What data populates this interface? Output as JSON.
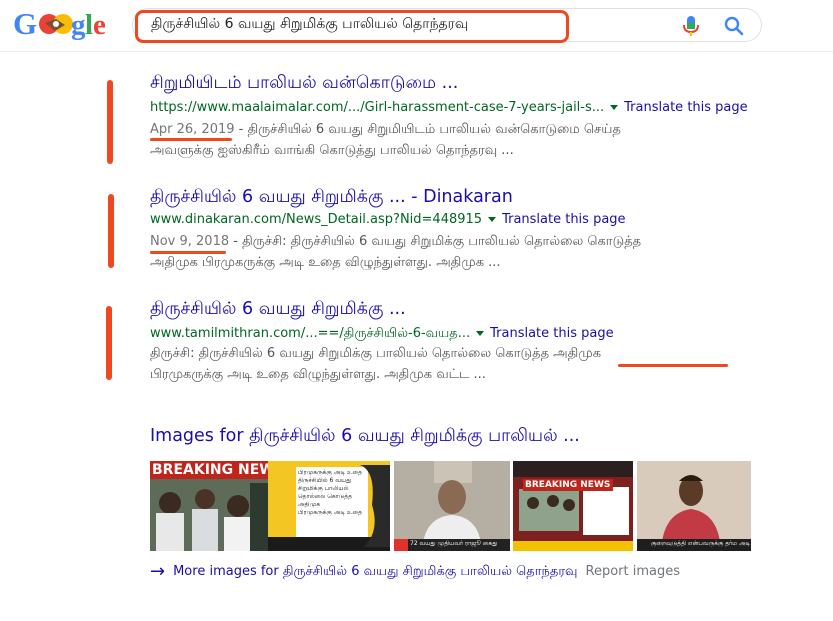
{
  "search": {
    "logo_text": "Google",
    "query": "திருச்சியில் 6 வயது சிறுமிக்கு பாலியல் தொந்தரவு",
    "mic_icon": "microphone-icon",
    "search_icon": "magnifier-icon"
  },
  "results": [
    {
      "title": "சிறுமியிடம் பாலியல் வன்கொடுமை ...",
      "url": "https://www.maalaimalar.com/.../Girl-harassment-case-7-years-jail-s...",
      "translate": "Translate this page",
      "date": "Apr 26, 2019",
      "sep": " - ",
      "snippet1": "திருச்சியில் 6 வயது சிறுமியிடம் பாலியல் வன்கொடுமை செய்த",
      "snippet2": "அவளுக்கு ஐஸ்கிரீம் வாங்கி கொடுத்து பாலியல் தொந்தரவு ..."
    },
    {
      "title": "திருச்சியில் 6 வயது சிறுமிக்கு ... - Dinakaran",
      "url": "www.dinakaran.com/News_Detail.asp?Nid=448915",
      "translate": "Translate this page",
      "date": "Nov 9, 2018",
      "sep": " - ",
      "snippet1": "திருச்சி: திருச்சியில் 6 வயது சிறுமிக்கு பாலியல் தொல்லை கொடுத்த",
      "snippet2": "அதிமுக பிரமுகருக்கு அடி உதை விழுந்துள்ளது. அதிமுக ..."
    },
    {
      "title": "திருச்சியில் 6 வயது சிறுமிக்கு ...",
      "url": "www.tamilmithran.com/...==/திருச்சியில்-6-வயத...",
      "translate": "Translate this page",
      "snippet1": "திருச்சி: திருச்சியில் 6 வயது சிறுமிக்கு பாலியல் தொல்லை கொடுத்த அதிமுக",
      "snippet2": "பிரமுகருக்கு அடி உதை விழுந்துள்ளது. அதிமுக வட்ட ..."
    }
  ],
  "images": {
    "heading": "Images for திருச்சியில் 6 வயது சிறுமிக்கு பாலியல் ...",
    "thumb1_banner": "BREAKING NEWS",
    "thumb2_lines": [
      "பிரமுகருக்கு அடி உதை",
      "திருச்சியில் 6 வயது",
      "சிறுமிக்கு பாலியல்",
      "தொல்லை கொடுத்த அதிமுக",
      "பிரமுகருக்கு அடி உதை"
    ],
    "thumb3_caption": "72 வயது முதியவர் ராஜூ கைது",
    "thumb4_banner": "BREAKING NEWS",
    "thumb5_caption": "குறைவுடுத்தி என்பவருக்கு தர்ம அடி",
    "more_arrow": "→",
    "more_text": "More images for திருச்சியில் 6 வயது சிறுமிக்கு பாலியல் தொந்தரவு",
    "report": "Report images"
  },
  "colors": {
    "link": "#1a0dab",
    "url_green": "#006621",
    "annotation_red": "#f0481e",
    "snippet_gray": "#545454"
  }
}
